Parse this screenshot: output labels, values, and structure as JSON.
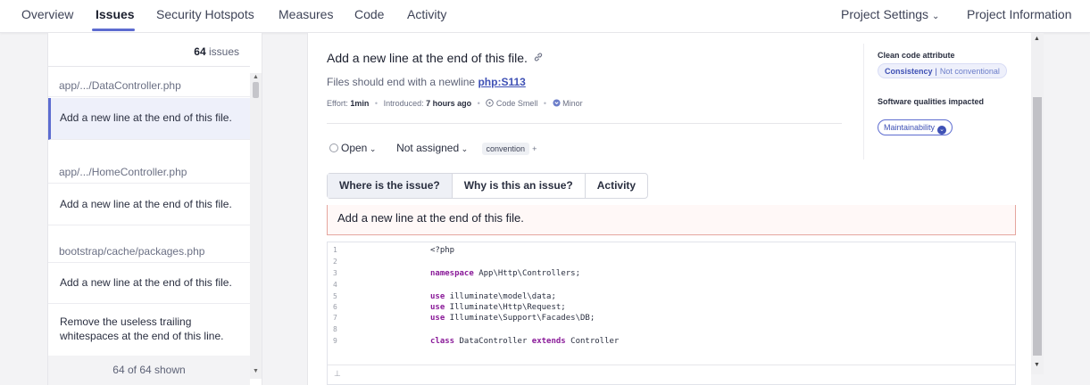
{
  "nav": {
    "tabs": [
      "Overview",
      "Issues",
      "Security Hotspots",
      "Measures",
      "Code",
      "Activity"
    ],
    "active_tab": "Issues",
    "project_settings": "Project Settings",
    "project_settings_chevron": "⌄",
    "project_information": "Project Information"
  },
  "issue_list": {
    "count_number": "64",
    "count_label": "issues",
    "shown": "64 of 64 shown",
    "groups": [
      {
        "file": "app/.../DataController.php",
        "issue": "Add a new line at the end of this file."
      },
      {
        "file": "app/.../HomeController.php",
        "issue": "Add a new line at the end of this file."
      },
      {
        "file": "bootstrap/cache/packages.php",
        "issue": "Add a new line at the end of this file."
      }
    ],
    "extra_issue": "Remove the useless trailing whitespaces at the end of this line."
  },
  "detail": {
    "title": "Add a new line at the end of this file.",
    "rule_text": "Files should end with a newline",
    "rule_key": "php:S113",
    "effort_label": "Effort:",
    "effort_value": "1min",
    "introduced_label": "Introduced:",
    "introduced_value": "7 hours ago",
    "type": "Code Smell",
    "severity": "Minor",
    "status": "Open",
    "assignee": "Not assigned",
    "tag": "convention",
    "tag_add": "+",
    "clean_code_label": "Clean code attribute",
    "attribute": "Consistency",
    "attribute_sub": "Not conventional",
    "qualities_label": "Software qualities impacted",
    "quality": "Maintainability",
    "tabs": [
      "Where is the issue?",
      "Why is this an issue?",
      "Activity"
    ],
    "active_tab": "Where is the issue?",
    "banner_text": "Add a new line at the end of this file."
  },
  "code": {
    "lines": [
      {
        "n": "1",
        "text": "<?php"
      },
      {
        "n": "2",
        "text": ""
      },
      {
        "n": "3",
        "kw": "namespace",
        "text": " App\\Http\\Controllers;"
      },
      {
        "n": "4",
        "text": ""
      },
      {
        "n": "5",
        "kw": "use",
        "text": " illuminate\\model\\data;"
      },
      {
        "n": "6",
        "kw": "use",
        "text": " Illuminate\\Http\\Request;"
      },
      {
        "n": "7",
        "kw": "use",
        "text": " Illuminate\\Support\\Facades\\DB;"
      },
      {
        "n": "8",
        "text": ""
      },
      {
        "n": "9",
        "kw": "class",
        "text": " DataController ",
        "kw2": "extends",
        "text2": " Controller"
      }
    ],
    "expand_icon": "expand-icon",
    "expand_glyph": "⊥"
  },
  "colors": {
    "accent": "#5d6cd0",
    "keyword": "#8a1b99",
    "banner_border": "#e5a69f"
  }
}
